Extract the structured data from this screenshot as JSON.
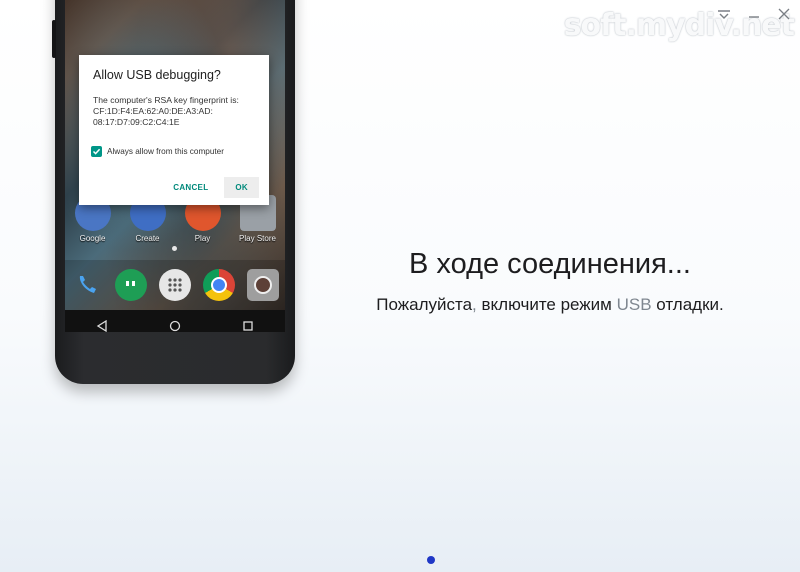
{
  "window": {
    "watermark": "soft.mydiv.net",
    "controls": [
      "menu-icon",
      "minimize-icon",
      "close-icon"
    ]
  },
  "dialog": {
    "title": "Allow USB debugging?",
    "body": "The computer's RSA key fingerprint is:\nCF:1D:F4:EA:62:A0:DE:A3:AD:\n08:17:D7:09:C2:C4:1E",
    "checkbox_label": "Always allow from this computer",
    "checkbox_checked": true,
    "cancel_label": "CANCEL",
    "ok_label": "OK",
    "accent_color": "#009688"
  },
  "phone": {
    "apps": [
      {
        "label": "Google",
        "icon": "google-icon"
      },
      {
        "label": "Create",
        "icon": "docs-icon"
      },
      {
        "label": "Play",
        "icon": "play-icon"
      },
      {
        "label": "Play Store",
        "icon": "play-store-icon"
      }
    ],
    "dock": [
      "phone-icon",
      "hangouts-icon",
      "apps-drawer-icon",
      "chrome-icon",
      "camera-icon"
    ],
    "navbar": [
      "back-icon",
      "home-icon",
      "recents-icon"
    ]
  },
  "main": {
    "title": "В ходе соединения...",
    "subtitle_part1": "Пожалуйста",
    "subtitle_part2": ",",
    "subtitle_part3": " включите режим ",
    "subtitle_part4": "USB",
    "subtitle_part5": " отладки."
  },
  "pager": {
    "active_color": "#1f37c6"
  }
}
